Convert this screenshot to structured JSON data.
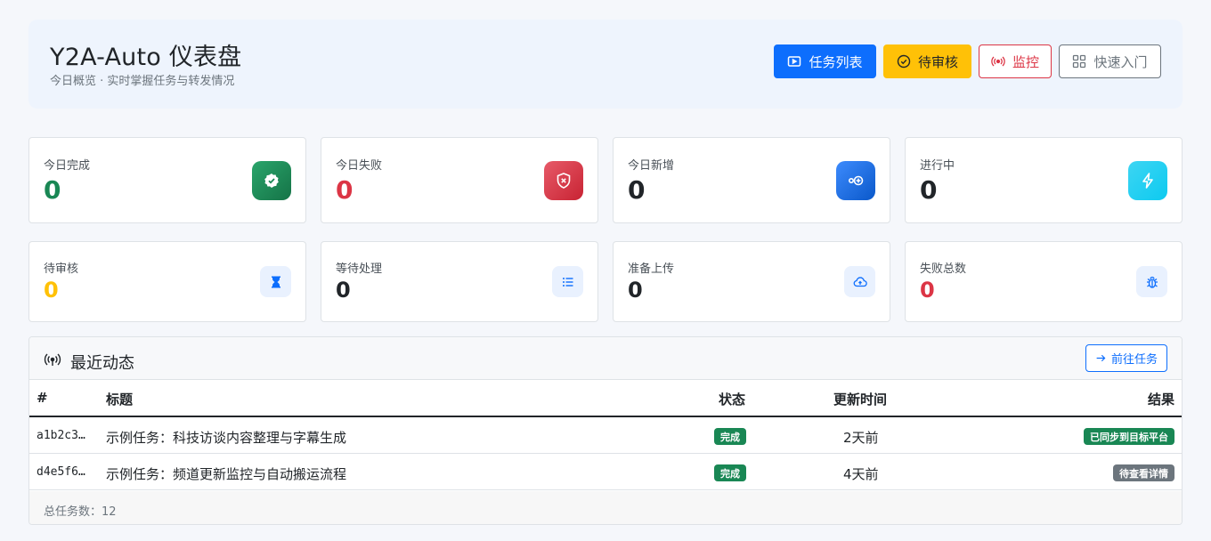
{
  "header": {
    "title": "Y2A-Auto 仪表盘",
    "subtitle": "今日概览 · 实时掌握任务与转发情况",
    "buttons": {
      "tasks": "任务列表",
      "review": "待审核",
      "monitor": "监控",
      "quick": "快速入门"
    }
  },
  "stats_row1": [
    {
      "label": "今日完成",
      "value": "0",
      "color": "#198754",
      "icon": "badge-check-icon"
    },
    {
      "label": "今日失败",
      "value": "0",
      "color": "#dc3545",
      "icon": "shield-x-icon"
    },
    {
      "label": "今日新增",
      "value": "0",
      "color": "#212529",
      "icon": "plus-circle-icon"
    },
    {
      "label": "进行中",
      "value": "0",
      "color": "#212529",
      "icon": "lightning-icon"
    }
  ],
  "stats_row2": [
    {
      "label": "待审核",
      "value": "0",
      "color": "#ffc107",
      "icon": "hourglass-icon"
    },
    {
      "label": "等待处理",
      "value": "0",
      "color": "#212529",
      "icon": "list-icon"
    },
    {
      "label": "准备上传",
      "value": "0",
      "color": "#212529",
      "icon": "cloud-upload-icon"
    },
    {
      "label": "失败总数",
      "value": "0",
      "color": "#dc3545",
      "icon": "bug-icon"
    }
  ],
  "recent": {
    "title": "最近动态",
    "goto_label": "前往任务",
    "columns": {
      "id": "#",
      "title": "标题",
      "status": "状态",
      "updated": "更新时间",
      "result": "结果"
    },
    "rows": [
      {
        "id": "a1b2c3…",
        "title": "示例任务：科技访谈内容整理与字幕生成",
        "status": "完成",
        "updated": "2天前",
        "result": "已同步到目标平台"
      },
      {
        "id": "d4e5f6…",
        "title": "示例任务：频道更新监控与自动搬运流程",
        "status": "完成",
        "updated": "4天前",
        "result": "待查看详情"
      }
    ],
    "footer": "总任务数：12"
  }
}
